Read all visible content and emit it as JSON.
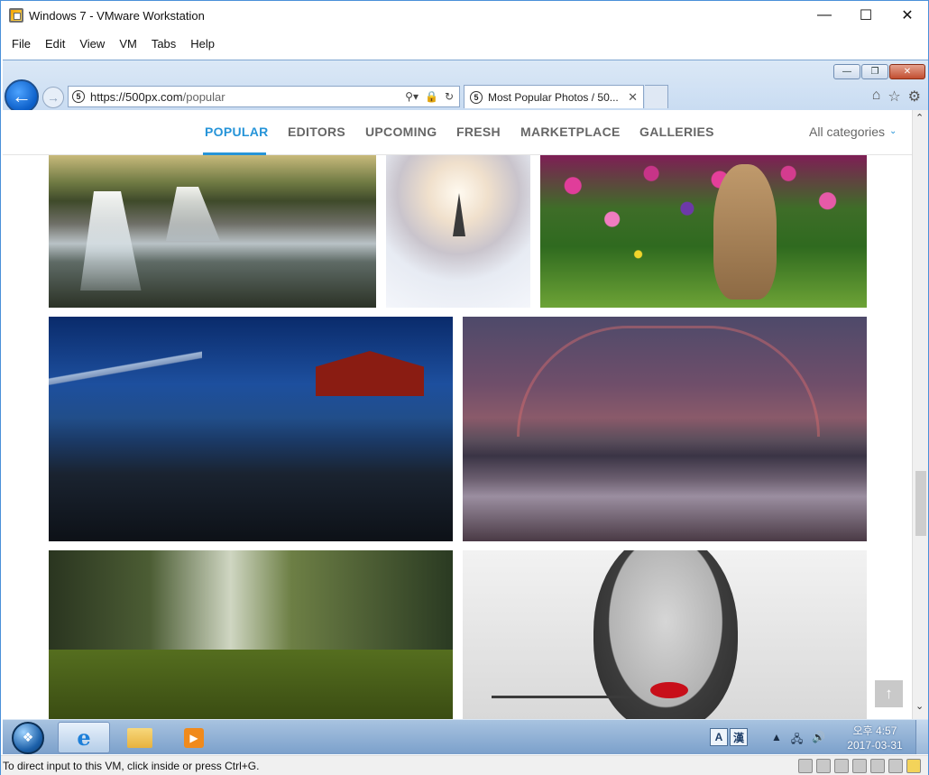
{
  "vmware": {
    "title": "Windows 7 - VMware Workstation",
    "menu": [
      "File",
      "Edit",
      "View",
      "VM",
      "Tabs",
      "Help"
    ],
    "status_text": "To direct input to this VM, click inside or press Ctrl+G."
  },
  "browser": {
    "url_host": "https://500px.com",
    "url_path": "/popular",
    "tab_title": "Most Popular Photos / 50...",
    "site_icon": "5"
  },
  "page": {
    "nav": [
      "POPULAR",
      "EDITORS",
      "UPCOMING",
      "FRESH",
      "MARKETPLACE",
      "GALLERIES"
    ],
    "active_nav": "POPULAR",
    "category": "All categories",
    "accent_color": "#2694d8"
  },
  "taskbar": {
    "ime_a": "A",
    "ime_han": "漢",
    "time": "오후 4:57",
    "date": "2017-03-31"
  }
}
